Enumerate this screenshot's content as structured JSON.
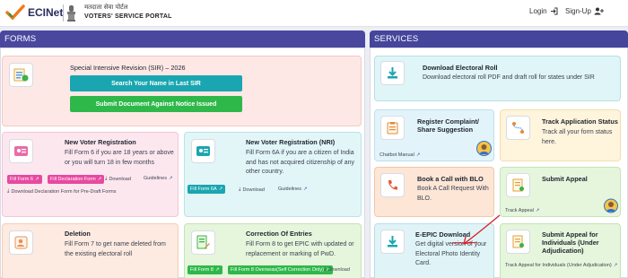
{
  "header": {
    "logo": "ECINet",
    "portal_hindi": "मतदाता सेवा पोर्टल",
    "portal_title": "VOTERS' SERVICE PORTAL",
    "login": "Login",
    "signup": "Sign-Up"
  },
  "forms": {
    "heading": "FORMS",
    "sir": {
      "title": "Special Intensive Revision (SIR) – 2026",
      "search_button": "Search Your Name in Last SIR",
      "submit_button": "Submit Document Against Notice Issued"
    },
    "new_voter": {
      "title": "New Voter Registration",
      "desc": "Fill Form 6 if you are 18 years or above or you will turn 18 in few months",
      "btn_form6": "Fill Form 6",
      "btn_declaration": "Fill Declaration Form",
      "download": "Download",
      "guidelines": "Guidelines",
      "declaration_link": "Download Declaration Form for Pre-Draft Forms"
    },
    "nri": {
      "title": "New Voter Registration (NRI)",
      "desc": "Fill Form 6A if you are a citizen of India and has not acquired citizenship of any other country.",
      "btn_form6a": "Fill Form 6A",
      "download": "Download",
      "guidelines": "Guidelines"
    },
    "deletion": {
      "title": "Deletion",
      "desc": "Fill Form 7 to get name deleted from the existing electoral roll"
    },
    "correction": {
      "title": "Correction Of Entries",
      "desc": "Fill Form 8 to get EPIC with updated or replacement or marking of PwD.",
      "btn_form8": "Fill Form 8",
      "btn_form8_overseas": "Fill Form 8 Overseas(Self Correction Only)",
      "download": "Download"
    }
  },
  "services": {
    "heading": "SERVICES",
    "electoral_roll": {
      "title": "Download Electoral Roll",
      "desc": "Download electoral roll PDF and draft roll for states under SIR"
    },
    "complaint": {
      "title": "Register Complaint/ Share Suggestion",
      "link": "Chatbot Manual"
    },
    "track": {
      "title": "Track Application Status",
      "desc": "Track all your form status here."
    },
    "blo": {
      "title": "Book a Call with BLO",
      "desc": "Book A Call Request With BLO."
    },
    "appeal": {
      "title": "Submit Appeal",
      "link": "Track Appeal"
    },
    "epic": {
      "title": "E-EPIC Download",
      "desc": "Get digital version of your Electoral Photo Identity Card."
    },
    "appeal_individuals": {
      "title": "Submit Appeal for Individuals (Under Adjudication)",
      "link": "Track Appeal for Individuals (Under Adjudication)"
    }
  },
  "colors": {
    "forms_head": "#49489e",
    "services_head": "#45459c",
    "pink_button": "#e64aa0",
    "teal_button": "#1aa6b0",
    "green_button": "#2fb84a"
  }
}
